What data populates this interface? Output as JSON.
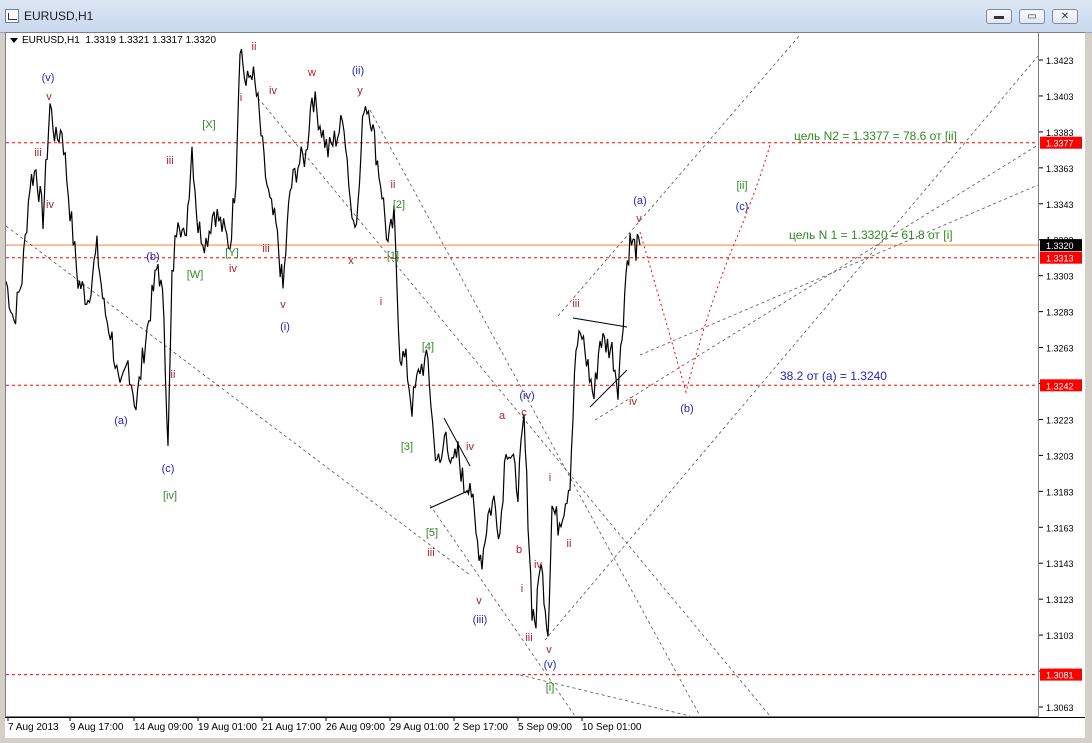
{
  "window": {
    "title": "EURUSD,H1",
    "buttons": {
      "minimize": "▬",
      "restore": "▭",
      "close": "✕"
    }
  },
  "chart_header": {
    "symbol": "EURUSD,H1",
    "ohlc": "1.3319 1.3321 1.3317 1.3320"
  },
  "chart_data": {
    "type": "candlestick-line",
    "symbol": "EURUSD",
    "timeframe": "H1",
    "ylim": [
      1.3055,
      1.344
    ],
    "y_ticks": [
      "1.3423",
      "1.3403",
      "1.3383",
      "1.3363",
      "1.3343",
      "1.3323",
      "1.3303",
      "1.3283",
      "1.3263",
      "1.3243",
      "1.3223",
      "1.3203",
      "1.3183",
      "1.3163",
      "1.3143",
      "1.3123",
      "1.3103",
      "1.3083",
      "1.3063"
    ],
    "x_ticks": [
      "7 Aug 2013",
      "9 Aug 17:00",
      "14 Aug 09:00",
      "19 Aug 01:00",
      "21 Aug 17:00",
      "26 Aug 09:00",
      "29 Aug 01:00",
      "2 Sep 17:00",
      "5 Sep 09:00",
      "10 Sep 01:00"
    ],
    "price_tags": [
      {
        "label": "1.3377",
        "value": 1.3377,
        "color": "#ff0000"
      },
      {
        "label": "1.3320",
        "value": 1.332,
        "color": "#000000"
      },
      {
        "label": "1.3313",
        "value": 1.3313,
        "color": "#ff0000"
      },
      {
        "label": "1.3242",
        "value": 1.3242,
        "color": "#ff0000"
      },
      {
        "label": "1.3081",
        "value": 1.3081,
        "color": "#ff0000"
      }
    ],
    "hlines": [
      {
        "value": 1.3377,
        "color": "#ff0000",
        "style": "dashed"
      },
      {
        "value": 1.332,
        "color": "#ff9966",
        "style": "solid"
      },
      {
        "value": 1.3313,
        "color": "#ff0000",
        "style": "dashed"
      },
      {
        "value": 1.3242,
        "color": "#ff0000",
        "style": "dashed"
      },
      {
        "value": 1.3081,
        "color": "#ff0000",
        "style": "dashed"
      }
    ],
    "annotations_text": [
      {
        "text": "цель N2 = 1.3377 =  78.6 от [ii]",
        "color": "#2e8b22"
      },
      {
        "text": "цель N 1 = 1.3320 = 61.8 от [i]",
        "color": "#2e8b22"
      },
      {
        "text": "38.2 от (a) = 1.3240",
        "color": "#2424b8"
      }
    ],
    "wave_labels": [
      {
        "t": "(v)",
        "x": 48,
        "y": 77,
        "c": "#2424b8"
      },
      {
        "t": "v",
        "x": 49,
        "y": 96,
        "c": "#b22222"
      },
      {
        "t": "iii",
        "x": 38,
        "y": 152,
        "c": "#b22222"
      },
      {
        "t": "iv",
        "x": 50,
        "y": 204,
        "c": "#b22222"
      },
      {
        "t": "(b)",
        "x": 153,
        "y": 256,
        "c": "#2424b8"
      },
      {
        "t": "(a)",
        "x": 121,
        "y": 420,
        "c": "#2424b8"
      },
      {
        "t": "iii",
        "x": 170,
        "y": 160,
        "c": "#b22222"
      },
      {
        "t": "ii",
        "x": 173,
        "y": 374,
        "c": "#b22222"
      },
      {
        "t": "(c)",
        "x": 168,
        "y": 468,
        "c": "#2424b8"
      },
      {
        "t": "[iv]",
        "x": 170,
        "y": 495,
        "c": "#2e8b22"
      },
      {
        "t": "[X]",
        "x": 209,
        "y": 124,
        "c": "#2e8b22"
      },
      {
        "t": "[W]",
        "x": 195,
        "y": 274,
        "c": "#2e8b22"
      },
      {
        "t": "[Y]",
        "x": 232,
        "y": 252,
        "c": "#2e8b22"
      },
      {
        "t": "iv",
        "x": 233,
        "y": 268,
        "c": "#b22222"
      },
      {
        "t": "ii",
        "x": 254,
        "y": 46,
        "c": "#b22222"
      },
      {
        "t": "i",
        "x": 241,
        "y": 97,
        "c": "#b22222"
      },
      {
        "t": "iv",
        "x": 273,
        "y": 90,
        "c": "#b22222"
      },
      {
        "t": "iii",
        "x": 266,
        "y": 248,
        "c": "#b22222"
      },
      {
        "t": "v",
        "x": 283,
        "y": 304,
        "c": "#b22222"
      },
      {
        "t": "(i)",
        "x": 285,
        "y": 326,
        "c": "#2424b8"
      },
      {
        "t": "w",
        "x": 312,
        "y": 72,
        "c": "#b22222"
      },
      {
        "t": "(ii)",
        "x": 358,
        "y": 70,
        "c": "#2424b8"
      },
      {
        "t": "y",
        "x": 360,
        "y": 90,
        "c": "#b22222"
      },
      {
        "t": "x",
        "x": 351,
        "y": 260,
        "c": "#b22222"
      },
      {
        "t": "ii",
        "x": 393,
        "y": 184,
        "c": "#b22222"
      },
      {
        "t": "[2]",
        "x": 399,
        "y": 204,
        "c": "#2e8b22"
      },
      {
        "t": "[1]",
        "x": 393,
        "y": 255,
        "c": "#2e8b22"
      },
      {
        "t": "i",
        "x": 381,
        "y": 301,
        "c": "#b22222"
      },
      {
        "t": "[4]",
        "x": 428,
        "y": 346,
        "c": "#2e8b22"
      },
      {
        "t": "[3]",
        "x": 407,
        "y": 446,
        "c": "#2e8b22"
      },
      {
        "t": "iv",
        "x": 470,
        "y": 446,
        "c": "#b22222"
      },
      {
        "t": "[5]",
        "x": 432,
        "y": 532,
        "c": "#2e8b22"
      },
      {
        "t": "iii",
        "x": 431,
        "y": 552,
        "c": "#b22222"
      },
      {
        "t": "v",
        "x": 479,
        "y": 600,
        "c": "#b22222"
      },
      {
        "t": "(iii)",
        "x": 480,
        "y": 619,
        "c": "#2424b8"
      },
      {
        "t": "a",
        "x": 502,
        "y": 415,
        "c": "#b22222"
      },
      {
        "t": "(iv)",
        "x": 527,
        "y": 395,
        "c": "#2424b8"
      },
      {
        "t": "c",
        "x": 524,
        "y": 412,
        "c": "#b22222"
      },
      {
        "t": "b",
        "x": 519,
        "y": 549,
        "c": "#b22222"
      },
      {
        "t": "i",
        "x": 550,
        "y": 477,
        "c": "#b22222"
      },
      {
        "t": "ii",
        "x": 569,
        "y": 543,
        "c": "#b22222"
      },
      {
        "t": "iv",
        "x": 538,
        "y": 564,
        "c": "#b22222"
      },
      {
        "t": "i",
        "x": 522,
        "y": 588,
        "c": "#b22222"
      },
      {
        "t": "iii",
        "x": 529,
        "y": 637,
        "c": "#b22222"
      },
      {
        "t": "v",
        "x": 549,
        "y": 649,
        "c": "#b22222"
      },
      {
        "t": "(v)",
        "x": 550,
        "y": 664,
        "c": "#2424b8"
      },
      {
        "t": "[i]",
        "x": 550,
        "y": 687,
        "c": "#2e8b22"
      },
      {
        "t": "iii",
        "x": 576,
        "y": 303,
        "c": "#b22222"
      },
      {
        "t": "iv",
        "x": 633,
        "y": 401,
        "c": "#b22222"
      },
      {
        "t": "(a)",
        "x": 640,
        "y": 200,
        "c": "#2424b8"
      },
      {
        "t": "v",
        "x": 639,
        "y": 218,
        "c": "#b22222"
      },
      {
        "t": "(b)",
        "x": 687,
        "y": 408,
        "c": "#2424b8"
      },
      {
        "t": "[ii]",
        "x": 742,
        "y": 185,
        "c": "#2e8b22"
      },
      {
        "t": "(c)",
        "x": 742,
        "y": 206,
        "c": "#2424b8"
      }
    ]
  }
}
